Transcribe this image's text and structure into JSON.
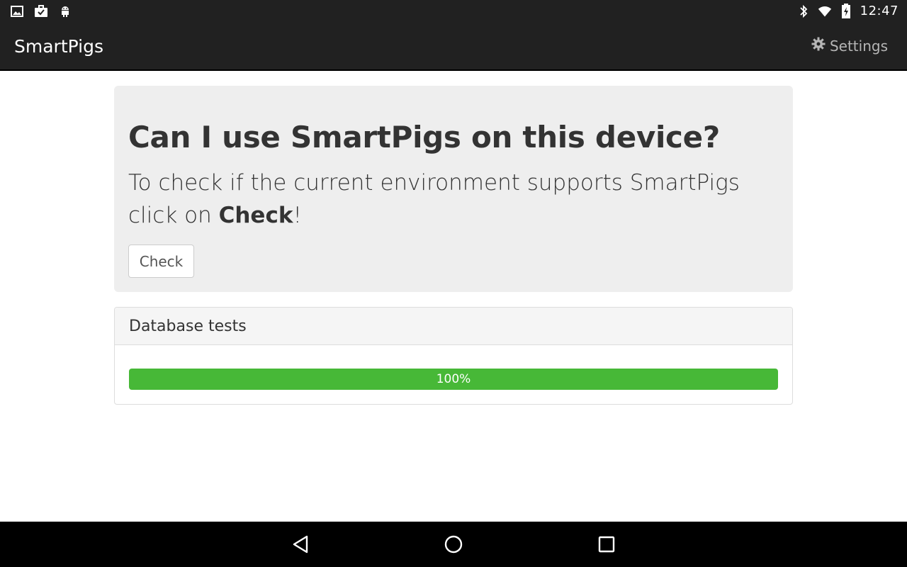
{
  "status_bar": {
    "time": "12:47",
    "left_icons": [
      "image-icon",
      "briefcase-check-icon",
      "android-icon"
    ],
    "right_icons": [
      "bluetooth-icon",
      "wifi-icon",
      "battery-charging-icon"
    ]
  },
  "app_bar": {
    "title": "SmartPigs",
    "settings_label": "Settings",
    "settings_icon": "gear-icon"
  },
  "jumbotron": {
    "heading": "Can I use SmartPigs on this device?",
    "lead_text": "To check if the current environment supports SmartPigs click on ",
    "lead_emphasis": "Check",
    "lead_suffix": "!",
    "check_button": "Check"
  },
  "panel": {
    "heading": "Database tests",
    "progress_label": "100%",
    "progress_value": 1.0
  },
  "colors": {
    "bar_bg": "#212121",
    "jumbotron_bg": "#eeeeee",
    "progress_fill": "#47b837",
    "settings_text": "#b5b5b5"
  },
  "nav_bar": {
    "buttons": [
      "back-icon",
      "home-icon",
      "recents-icon"
    ]
  }
}
